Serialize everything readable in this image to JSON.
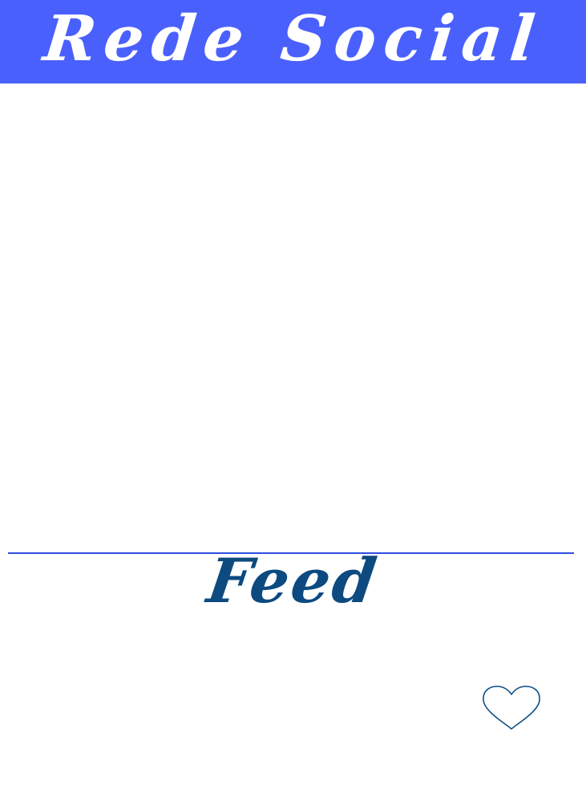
{
  "header": {
    "title": "Rede Social"
  },
  "feed": {
    "title": "Feed",
    "like_icon": "heart-outline-icon"
  },
  "colors": {
    "header_bg": "#4a60fd",
    "header_text": "#ffffff",
    "divider": "#2f4ee0",
    "feed_title": "#0c4a80",
    "heart_stroke": "#0e4f86",
    "background": "#ffffff"
  }
}
